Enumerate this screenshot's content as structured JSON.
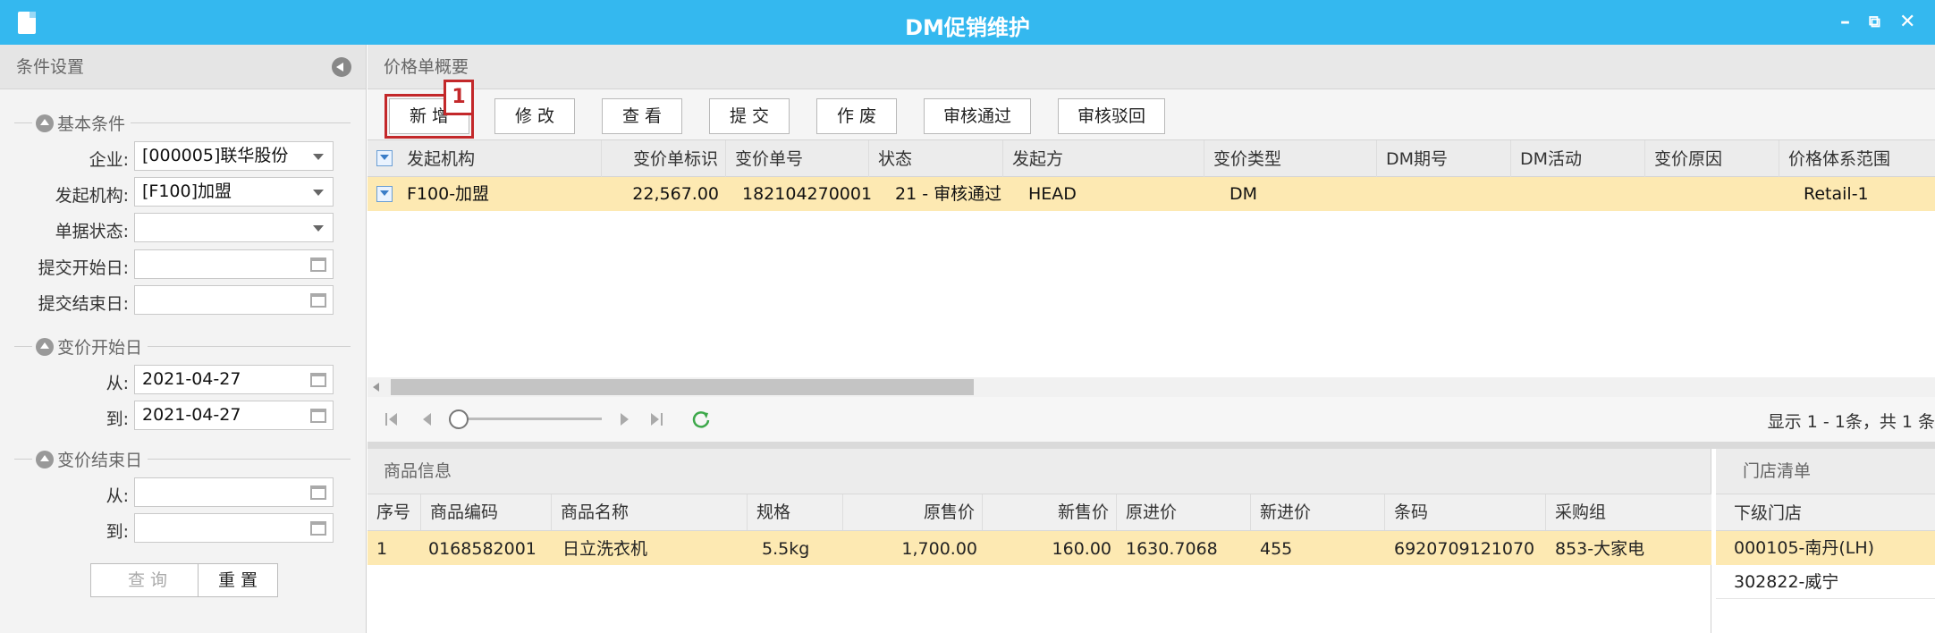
{
  "window": {
    "title": "DM促销维护",
    "minimize": "–",
    "restore": "⧉",
    "close": "✕"
  },
  "left_panel": {
    "title": "条件设置",
    "basic": {
      "title": "基本条件",
      "company_label": "企业:",
      "company_value": "[000005]联华股份",
      "org_label": "发起机构:",
      "org_value": "[F100]加盟",
      "status_label": "单据状态:",
      "status_value": "",
      "submit_start_label": "提交开始日:",
      "submit_start_value": "",
      "submit_end_label": "提交结束日:",
      "submit_end_value": ""
    },
    "change_start": {
      "title": "变价开始日",
      "from_label": "从:",
      "from_value": "2021-04-27",
      "to_label": "到:",
      "to_value": "2021-04-27"
    },
    "change_end": {
      "title": "变价结束日",
      "from_label": "从:",
      "from_value": "",
      "to_label": "到:",
      "to_value": ""
    },
    "query_label": "查 询",
    "reset_label": "重 置"
  },
  "main": {
    "title": "价格单概要",
    "toolbar": {
      "add": "新 增",
      "edit": "修 改",
      "view": "查 看",
      "submit": "提 交",
      "void": "作 废",
      "approve": "审核通过",
      "reject": "审核驳回"
    },
    "callout_number": "1",
    "columns": [
      "发起机构",
      "变价单标识",
      "变价单号",
      "状态",
      "发起方",
      "变价类型",
      "DM期号",
      "DM活动",
      "变价原因",
      "价格体系范围"
    ],
    "rows": [
      {
        "org": "F100-加盟",
        "id": "22,567.00",
        "no": "182104270001",
        "status": "21 - 审核通过",
        "initiator": "HEAD",
        "type": "DM",
        "period": "",
        "activity": "",
        "reason": "",
        "range": "Retail-1"
      }
    ],
    "pager_info": "显示 1 - 1条，共 1 条"
  },
  "products": {
    "title": "商品信息",
    "columns": [
      "序号",
      "商品编码",
      "商品名称",
      "规格",
      "原售价",
      "新售价",
      "原进价",
      "新进价",
      "条码",
      "采购组"
    ],
    "rows": [
      {
        "seq": "1",
        "code": "0168582001",
        "name": "日立洗衣机",
        "spec": "5.5kg",
        "old_price": "1,700.00",
        "new_price": "160.00",
        "old_cost": "1630.7068",
        "new_cost": "455",
        "barcode": "6920709121070",
        "group": "853-大家电"
      }
    ]
  },
  "stores": {
    "title": "门店清单",
    "column": "下级门店",
    "rows": [
      "000105-南丹(LH)",
      "302822-威宁"
    ]
  },
  "colors": {
    "title_bar": "#34b8ef",
    "selected_row": "#fde9b2",
    "callout": "#c3282a"
  }
}
